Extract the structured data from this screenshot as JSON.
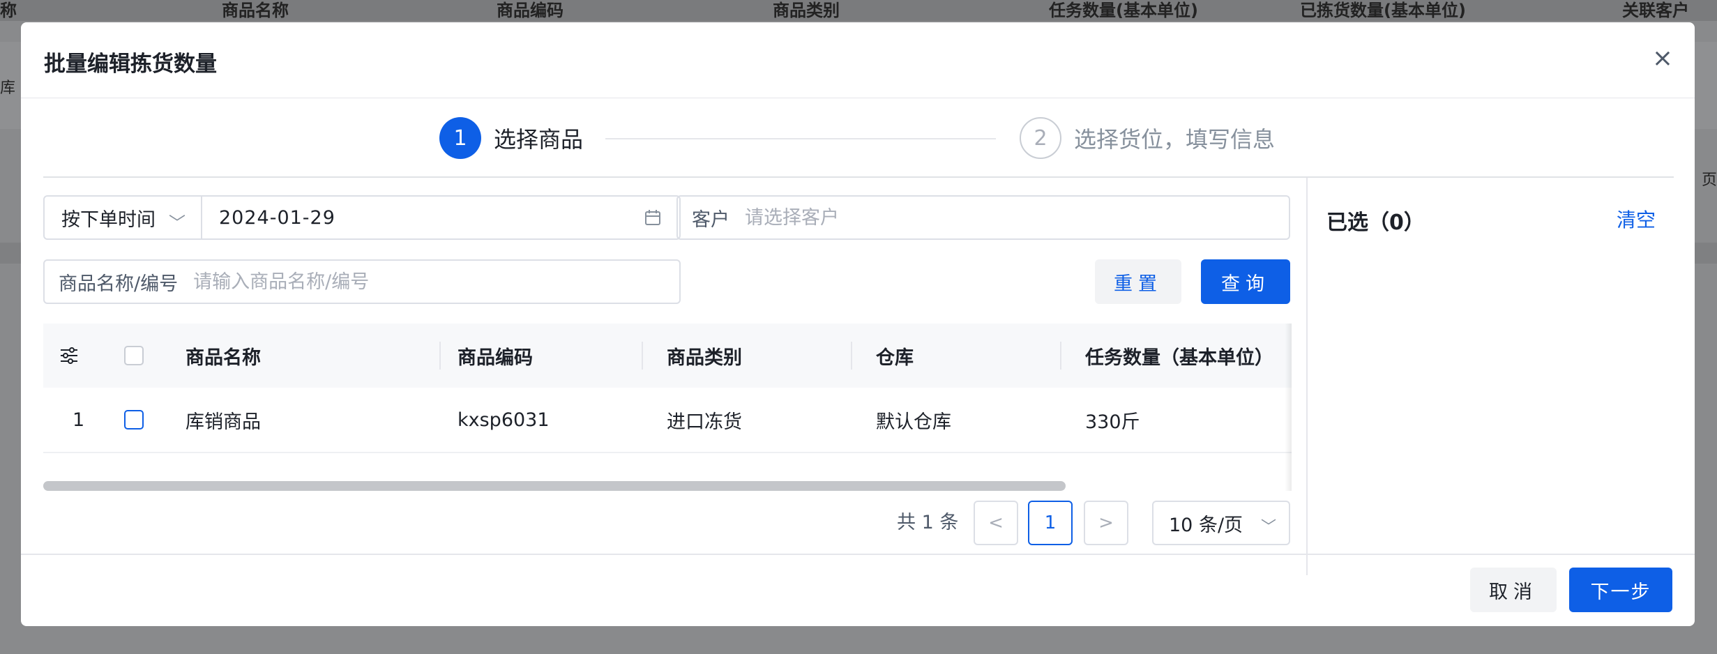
{
  "background": {
    "header_columns": [
      "称",
      "商品名称",
      "商品编码",
      "商品类别",
      "任务数量(基本单位)",
      "已拣货数量(基本单位)",
      "关联客户"
    ],
    "left_fragment": "库",
    "right_fragment": "页"
  },
  "modal": {
    "title": "批量编辑拣货数量",
    "close_glyph": "×",
    "steps": [
      {
        "number": "1",
        "label": "选择商品",
        "active": true
      },
      {
        "number": "2",
        "label": "选择货位，填写信息",
        "active": false
      }
    ],
    "filters": {
      "date_type": "按下单时间",
      "date_value": "2024-01-29",
      "customer_label": "客户",
      "customer_placeholder": "请选择客户",
      "product_label": "商品名称/编号",
      "product_placeholder": "请输入商品名称/编号",
      "reset_label": "重置",
      "query_label": "查询"
    },
    "table": {
      "columns": [
        "商品名称",
        "商品编码",
        "商品类别",
        "仓库",
        "任务数量（基本单位）"
      ],
      "rows": [
        {
          "index": "1",
          "name": "库销商品",
          "code": "kxsp6031",
          "category": "进口冻货",
          "warehouse": "默认仓库",
          "task_qty": "330斤"
        }
      ]
    },
    "pagination": {
      "total": "共 1 条",
      "prev": "<",
      "current": "1",
      "next": ">",
      "page_size": "10 条/页"
    },
    "selected_panel": {
      "title": "已选（0）",
      "clear_label": "清空"
    },
    "footer": {
      "cancel_label": "取消",
      "next_label": "下一步"
    },
    "colors": {
      "primary": "#0e5fe6",
      "border": "#dcdfe6",
      "header_bg": "#f7f8fa"
    }
  }
}
